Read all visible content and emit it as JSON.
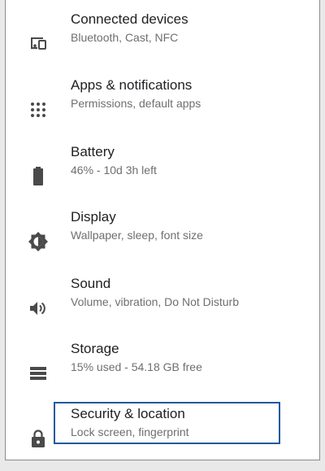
{
  "settings": {
    "items": [
      {
        "title": "Connected devices",
        "subtitle": "Bluetooth, Cast, NFC",
        "icon": "connected-devices-icon"
      },
      {
        "title": "Apps & notifications",
        "subtitle": "Permissions, default apps",
        "icon": "apps-grid-icon"
      },
      {
        "title": "Battery",
        "subtitle": "46% - 10d 3h left",
        "icon": "battery-icon"
      },
      {
        "title": "Display",
        "subtitle": "Wallpaper, sleep, font size",
        "icon": "brightness-icon"
      },
      {
        "title": "Sound",
        "subtitle": "Volume, vibration, Do Not Disturb",
        "icon": "volume-icon"
      },
      {
        "title": "Storage",
        "subtitle": "15% used - 54.18 GB free",
        "icon": "storage-icon"
      },
      {
        "title": "Security & location",
        "subtitle": "Lock screen, fingerprint",
        "icon": "lock-icon"
      }
    ],
    "colors": {
      "icon": "#4a4a4a",
      "title": "#202124",
      "subtitle": "#6f6f6f",
      "focus_border": "#1f5a9c"
    }
  }
}
